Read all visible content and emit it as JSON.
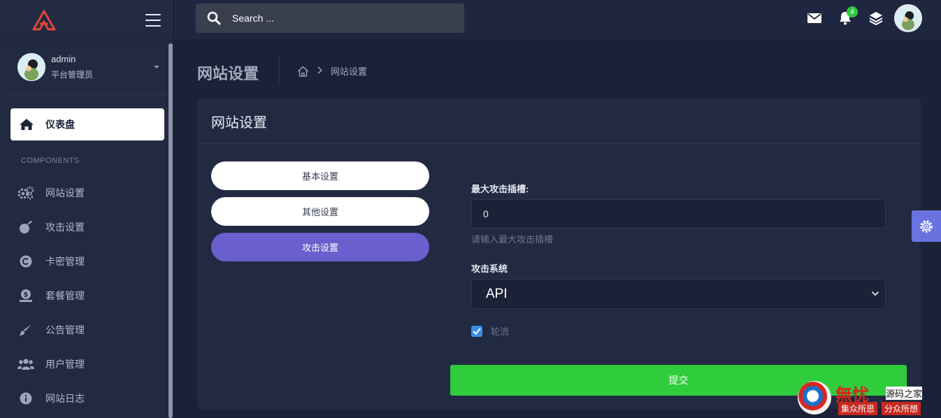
{
  "sidebar": {
    "user": {
      "name": "admin",
      "role": "平台管理员"
    },
    "active_item": {
      "label": "仪表盘",
      "icon": "home-icon"
    },
    "section_label": "COMPONENTS",
    "items": [
      {
        "label": "网站设置",
        "icon": "cogs-icon"
      },
      {
        "label": "攻击设置",
        "icon": "bomb-icon"
      },
      {
        "label": "卡密管理",
        "icon": "copyright-icon"
      },
      {
        "label": "套餐管理",
        "icon": "money-icon"
      },
      {
        "label": "公告管理",
        "icon": "brush-icon"
      },
      {
        "label": "用户管理",
        "icon": "users-icon"
      },
      {
        "label": "网站日志",
        "icon": "info-icon"
      }
    ]
  },
  "topbar": {
    "search_placeholder": "Search ...",
    "notification_count": "4",
    "icons": [
      "mail-icon",
      "bell-icon",
      "layers-icon",
      "avatar"
    ]
  },
  "page": {
    "title": "网站设置",
    "breadcrumb_current": "网站设置"
  },
  "card": {
    "title": "网站设置",
    "tabs": [
      {
        "label": "基本设置",
        "active": false
      },
      {
        "label": "其他设置",
        "active": false
      },
      {
        "label": "攻击设置",
        "active": true
      }
    ],
    "form": {
      "max_slots_label": "最大攻击插槽:",
      "max_slots_value": "0",
      "max_slots_help": "请输入最大攻击插槽",
      "system_label": "攻击系统",
      "system_selected": "API",
      "rotate_label": "轮流",
      "rotate_checked": true,
      "submit_label": "提交"
    }
  },
  "watermark": {
    "big": "無忧",
    "small": "源码之家",
    "row2_left": "集众所思",
    "row2_right": "分众所想"
  },
  "colors": {
    "background": "#1b2238",
    "sidebar": "#222a42",
    "accent_purple": "#6a5fcd",
    "submit_green": "#2fcc3b",
    "badge_green": "#2fc73c",
    "settings_fab": "#6873e0"
  }
}
